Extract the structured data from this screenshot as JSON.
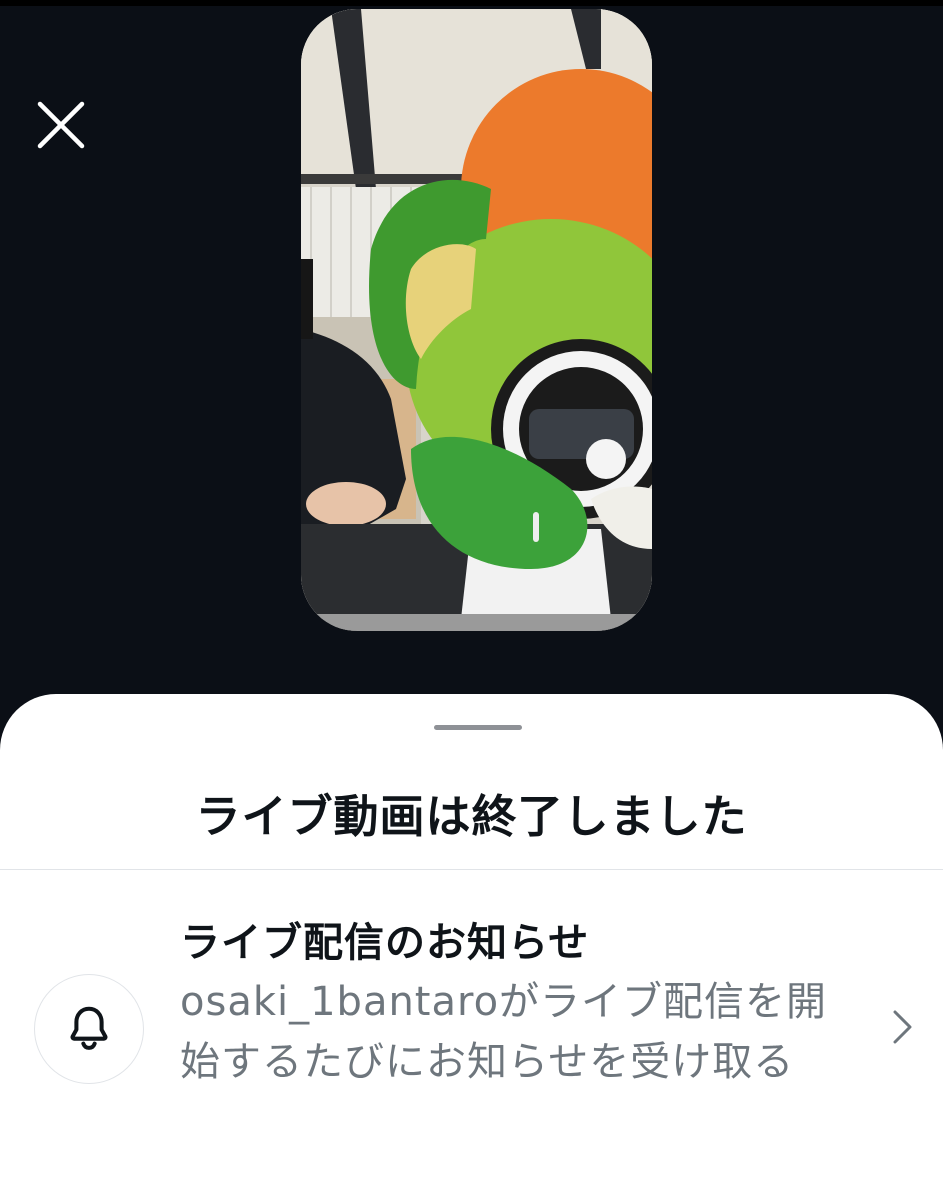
{
  "header": {
    "close_icon": "close-icon"
  },
  "video": {
    "description_icon": "video-thumbnail"
  },
  "sheet": {
    "title": "ライブ動画は終了しました",
    "notification": {
      "icon": "bell-icon",
      "title": "ライブ配信のお知らせ",
      "description": "osaki_1bantaroがライブ配信を開始するたびにお知らせを受け取る",
      "chevron_icon": "chevron-right-icon"
    }
  },
  "colors": {
    "background": "#0b0f16",
    "sheet": "#ffffff",
    "primary_text": "#0f1419",
    "secondary_text": "#6e767d"
  }
}
